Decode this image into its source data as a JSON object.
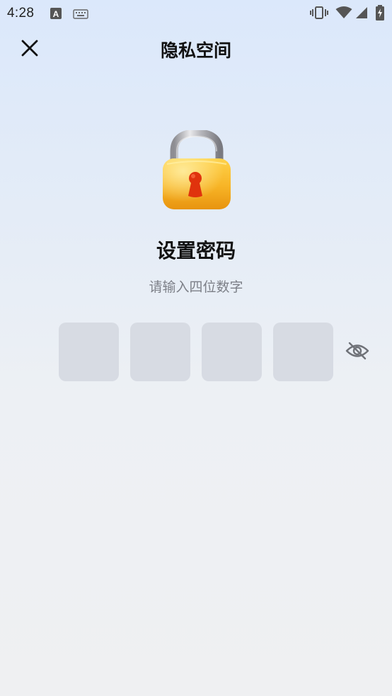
{
  "status_bar": {
    "time": "4:28",
    "left_icons": [
      "font-a-icon",
      "keyboard-icon"
    ],
    "right_icons": [
      "vibrate-icon",
      "wifi-icon",
      "signal-icon",
      "battery-charging-icon"
    ]
  },
  "header": {
    "title": "隐私空间",
    "close_icon": "close-icon"
  },
  "main": {
    "illustration": "padlock-icon",
    "title": "设置密码",
    "subtitle": "请输入四位数字",
    "pin_length": 4,
    "pin_values": [
      "",
      "",
      "",
      ""
    ],
    "visibility_icon": "eye-hidden-icon"
  },
  "colors": {
    "pin_box": "#d7dbe3",
    "subtitle": "#7d8088",
    "lock_body": "#f5b623",
    "keyhole": "#e0330d"
  }
}
